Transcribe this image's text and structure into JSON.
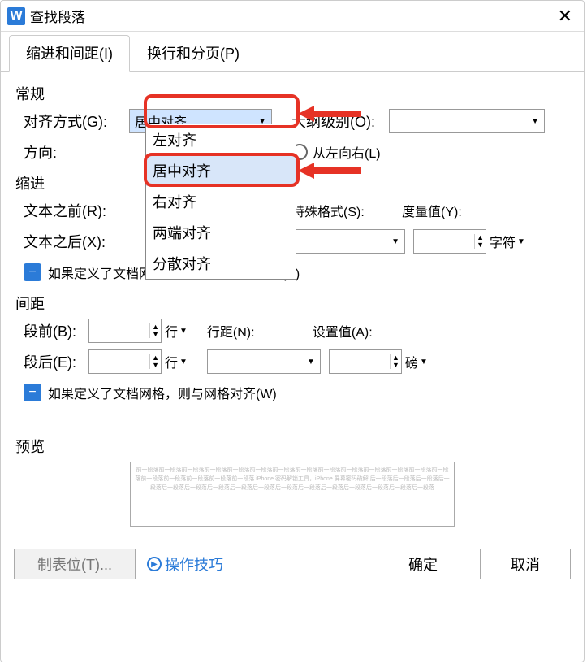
{
  "window": {
    "title": "查找段落"
  },
  "tabs": {
    "indent": "缩进和间距(I)",
    "page": "换行和分页(P)"
  },
  "general": {
    "header": "常规",
    "align_label": "对齐方式(G):",
    "align_value": "居中对齐",
    "outline_label": "大纲级别(O):",
    "direction_label": "方向:",
    "rtl_label": "从左向右(L)"
  },
  "align_options": {
    "left": "左对齐",
    "center": "居中对齐",
    "right": "右对齐",
    "justify": "两端对齐",
    "distribute": "分散对齐"
  },
  "indent": {
    "header": "缩进",
    "before_label": "文本之前(R):",
    "after_label": "文本之后(X):",
    "special_label": "特殊格式(S):",
    "measure_label": "度量值(Y):",
    "unit": "字符",
    "chk_label": "如果定义了文档网格，则自动调整右缩进(D)"
  },
  "indent_occluded": "如果定义了",
  "indent_occluded_tail": "调整右缩进(D)",
  "spacing": {
    "header": "间距",
    "before_label": "段前(B):",
    "after_label": "段后(E):",
    "line_unit": "行",
    "lineheight_label": "行距(N):",
    "setvalue_label": "设置值(A):",
    "unit": "磅",
    "chk_label": "如果定义了文档网格，则与网格对齐(W)"
  },
  "preview": {
    "header": "预览",
    "text": "前一段落前一段落前一段落前一段落前一段落前一段落前一段落前一段落前一段落前一段落前一段落前一段落前一段落前一段落前一段落前一段落前一段落前一段落前一段落\niPhone 密码解锁工具，iPhone 屏幕密码破解\n后一段落后一段落后一段落后一段落后一段落后一段落后一段落后一段落后一段落后一段落后一段落后一段落后一段落后一段落后一段落后一段落"
  },
  "footer": {
    "tabs_btn": "制表位(T)...",
    "tips": "操作技巧",
    "ok": "确定",
    "cancel": "取消"
  },
  "icons": {
    "app": "W"
  }
}
